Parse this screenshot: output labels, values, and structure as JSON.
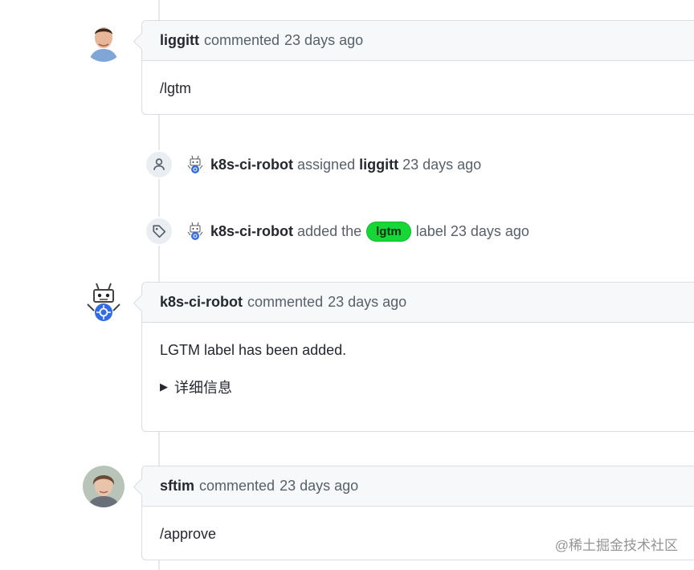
{
  "comments": [
    {
      "author": "liggitt",
      "verb": "commented",
      "time": "23 days ago",
      "body": "/lgtm"
    },
    {
      "author": "k8s-ci-robot",
      "verb": "commented",
      "time": "23 days ago",
      "body": "LGTM label has been added.",
      "details_label": "详细信息"
    },
    {
      "author": "sftim",
      "verb": "commented",
      "time": "23 days ago",
      "body": "/approve"
    }
  ],
  "events": [
    {
      "icon": "person-icon",
      "actor": "k8s-ci-robot",
      "action": "assigned",
      "target": "liggitt",
      "time": "23 days ago"
    },
    {
      "icon": "tag-icon",
      "actor": "k8s-ci-robot",
      "action_before": "added the",
      "label": "lgtm",
      "label_color": "#15d836",
      "action_after": "label",
      "time": "23 days ago"
    }
  ],
  "watermark": "@稀土掘金技术社区"
}
